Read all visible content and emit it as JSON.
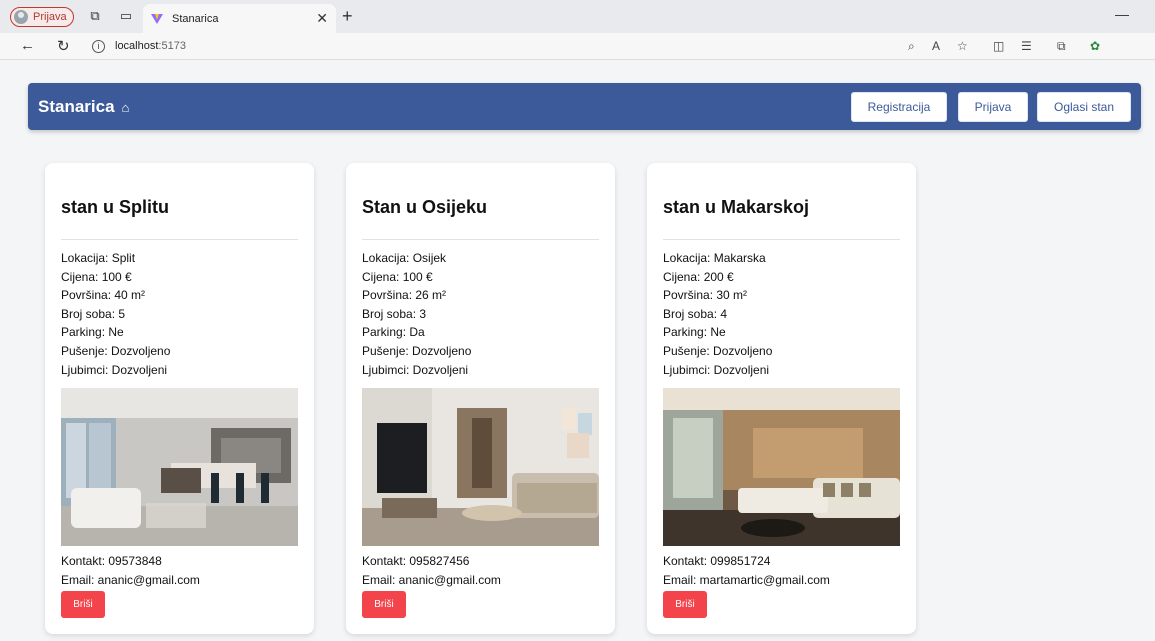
{
  "browser": {
    "profile_label": "Prijava",
    "tab_title": "Stanarica",
    "url_host": "localhost",
    "url_port": ":5173"
  },
  "app": {
    "brand": "Stanarica",
    "nav": {
      "register": "Registracija",
      "login": "Prijava",
      "post": "Oglasi stan"
    }
  },
  "listings": [
    {
      "title": "stan u Splitu",
      "location": "Lokacija: Split",
      "price": "Cijena: 100 €",
      "area": "Površina: 40 m²",
      "rooms": "Broj soba: 5",
      "parking": "Parking: Ne",
      "smoking": "Pušenje: Dozvoljeno",
      "pets": "Ljubimci: Dozvoljeni",
      "contact": "Kontakt: 09573848",
      "email": "Email: ananic@gmail.com",
      "delete_label": "Briši"
    },
    {
      "title": "Stan u Osijeku",
      "location": "Lokacija: Osijek",
      "price": "Cijena: 100 €",
      "area": "Površina: 26 m²",
      "rooms": "Broj soba: 3",
      "parking": "Parking: Da",
      "smoking": "Pušenje: Dozvoljeno",
      "pets": "Ljubimci: Dozvoljeni",
      "contact": "Kontakt: 095827456",
      "email": "Email: ananic@gmail.com",
      "delete_label": "Briši"
    },
    {
      "title": "stan u Makarskoj",
      "location": "Lokacija: Makarska",
      "price": "Cijena: 200 €",
      "area": "Površina: 30 m²",
      "rooms": "Broj soba: 4",
      "parking": "Parking: Ne",
      "smoking": "Pušenje: Dozvoljeno",
      "pets": "Ljubimci: Dozvoljeni",
      "contact": "Kontakt: 099851724",
      "email": "Email: martamartic@gmail.com",
      "delete_label": "Briši"
    }
  ],
  "colors": {
    "header_bg": "#3c5a9a",
    "delete_bg": "#f2444a"
  }
}
